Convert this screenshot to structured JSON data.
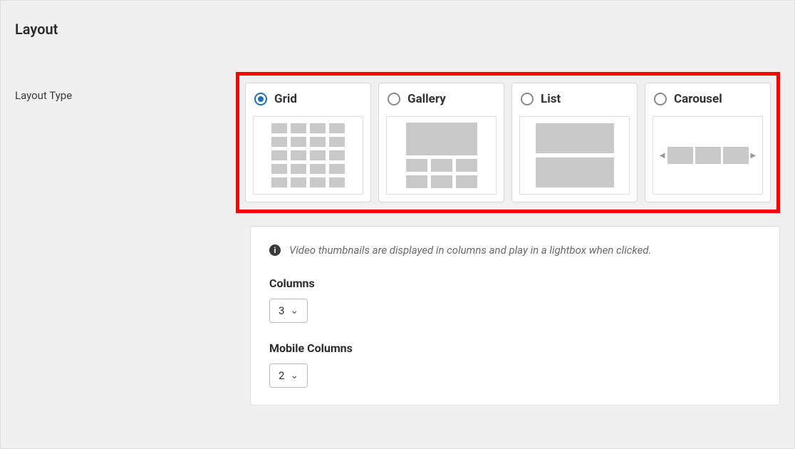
{
  "section_title": "Layout",
  "layout_type": {
    "label": "Layout Type",
    "options": [
      {
        "key": "grid",
        "label": "Grid",
        "selected": true
      },
      {
        "key": "gallery",
        "label": "Gallery",
        "selected": false
      },
      {
        "key": "list",
        "label": "List",
        "selected": false
      },
      {
        "key": "carousel",
        "label": "Carousel",
        "selected": false
      }
    ]
  },
  "info_text": "Video thumbnails are displayed in columns and play in a lightbox when clicked.",
  "columns": {
    "label": "Columns",
    "value": "3"
  },
  "mobile_columns": {
    "label": "Mobile Columns",
    "value": "2"
  }
}
